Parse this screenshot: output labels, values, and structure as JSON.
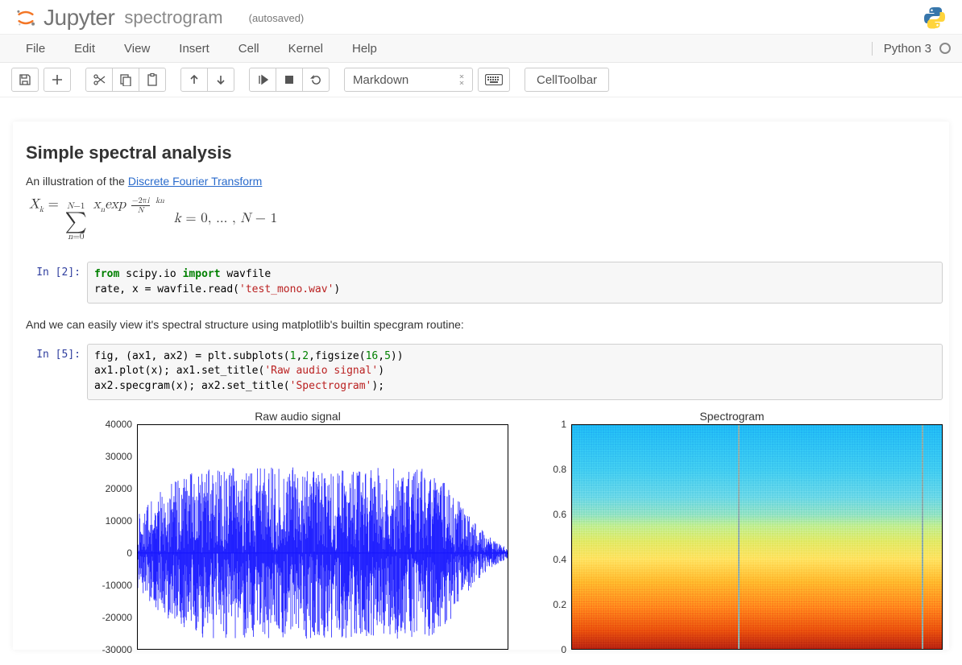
{
  "header": {
    "app_name": "Jupyter",
    "notebook_name": "spectrogram",
    "autosave": "(autosaved)"
  },
  "menubar": {
    "items": [
      "File",
      "Edit",
      "View",
      "Insert",
      "Cell",
      "Kernel",
      "Help"
    ],
    "kernel_name": "Python 3"
  },
  "toolbar": {
    "celltype_selected": "Markdown",
    "cell_toolbar_label": "CellToolbar"
  },
  "cells": {
    "md_heading": "Simple spectral analysis",
    "md_intro_prefix": "An illustration of the ",
    "md_intro_link": "Discrete Fourier Transform",
    "formula_latex": "X_k = \\sum_{n=0}^{N-1} x_n \\exp^{\\frac{-2\\pi i}{N} kn} \\quad k = 0,\\ldots,N-1",
    "code2_prompt": "In [2]:",
    "code2_lines": [
      {
        "t": "kw",
        "v": "from "
      },
      {
        "t": "p",
        "v": "scipy.io "
      },
      {
        "t": "kw",
        "v": "import "
      },
      {
        "t": "p",
        "v": "wavfile"
      },
      {
        "t": "br"
      },
      {
        "t": "p",
        "v": "rate, x = wavfile.read("
      },
      {
        "t": "str",
        "v": "'test_mono.wav'"
      },
      {
        "t": "p",
        "v": ")"
      }
    ],
    "md_mid": "And we can easily view it's spectral structure using matplotlib's builtin specgram routine:",
    "code5_prompt": "In [5]:",
    "code5_lines": [
      {
        "t": "p",
        "v": "fig, (ax1, ax2) = plt.subplots("
      },
      {
        "t": "num",
        "v": "1"
      },
      {
        "t": "p",
        "v": ","
      },
      {
        "t": "num",
        "v": "2"
      },
      {
        "t": "p",
        "v": ",figsize("
      },
      {
        "t": "num",
        "v": "16"
      },
      {
        "t": "p",
        "v": ","
      },
      {
        "t": "num",
        "v": "5"
      },
      {
        "t": "p",
        "v": "))"
      },
      {
        "t": "br"
      },
      {
        "t": "p",
        "v": "ax1.plot(x); ax1.set_title("
      },
      {
        "t": "str",
        "v": "'Raw audio signal'"
      },
      {
        "t": "p",
        "v": ")"
      },
      {
        "t": "br"
      },
      {
        "t": "p",
        "v": "ax2.specgram(x); ax2.set_title("
      },
      {
        "t": "str",
        "v": "'Spectrogram'"
      },
      {
        "t": "p",
        "v": ");"
      }
    ],
    "plot_left_title": "Raw audio signal",
    "plot_right_title": "Spectrogram"
  },
  "chart_data": [
    {
      "type": "line",
      "title": "Raw audio signal",
      "ylabel": "",
      "y_ticks": [
        40000,
        30000,
        20000,
        10000,
        0,
        -10000,
        -20000,
        -30000
      ],
      "ylim": [
        -30000,
        40000
      ],
      "description": "Dense blue waveform (audio amplitude vs sample index), roughly centered at 0 with bursts reaching ≈ +30000 / -25000, tapering toward the end."
    },
    {
      "type": "heatmap",
      "title": "Spectrogram",
      "y_ticks": [
        1.0,
        0.8,
        0.6,
        0.4,
        0.2,
        0.0
      ],
      "ylim": [
        0.0,
        1.0
      ],
      "colormap": "jet",
      "description": "Time-frequency spectrogram: low frequencies (bottom ~0–0.35) hot red/orange, mid band yellow-green, upper half cyan/blue; faint vertical artifacts around 45% and 95% width."
    }
  ]
}
